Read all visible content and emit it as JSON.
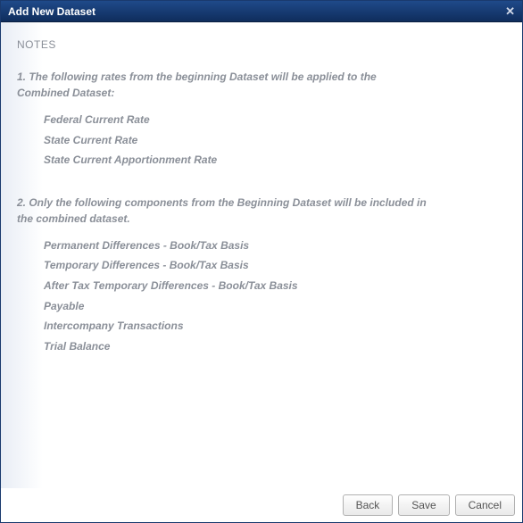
{
  "dialog": {
    "title": "Add New Dataset"
  },
  "notes": {
    "heading": "NOTES",
    "para1": "1.  The following rates from the beginning Dataset will be applied to the Combined Dataset:",
    "list1": [
      "Federal Current Rate",
      "State Current Rate",
      "State Current Apportionment Rate"
    ],
    "para2": "2.  Only the following components from the Beginning Dataset will be included in the combined dataset.",
    "list2": [
      "Permanent Differences - Book/Tax Basis",
      "Temporary Differences - Book/Tax Basis",
      "After Tax Temporary Differences - Book/Tax Basis",
      "Payable",
      "Intercompany Transactions",
      "Trial Balance"
    ]
  },
  "buttons": {
    "back": "Back",
    "save": "Save",
    "cancel": "Cancel"
  }
}
